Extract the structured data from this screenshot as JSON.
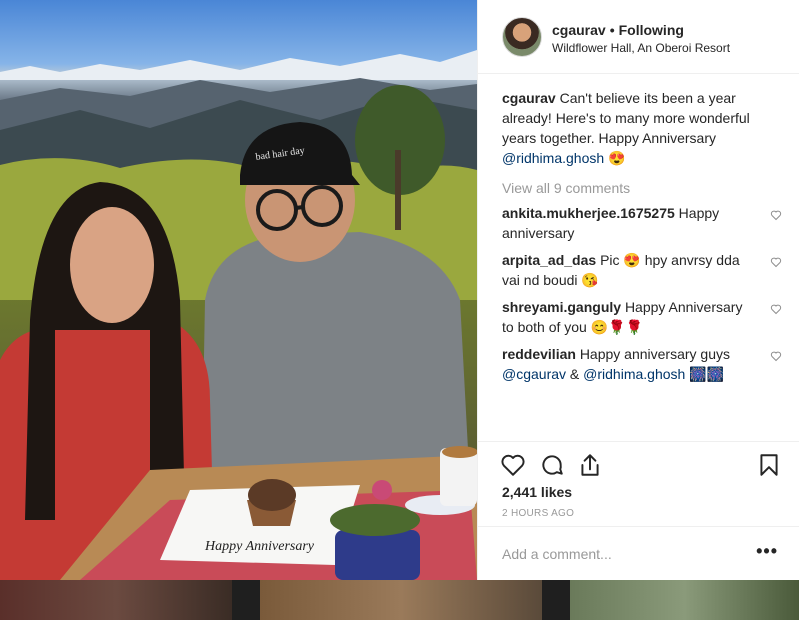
{
  "post": {
    "username": "cgaurav",
    "separator": "•",
    "follow_status": "Following",
    "location": "Wildflower Hall, An Oberoi Resort",
    "caption": {
      "username": "cgaurav",
      "text": "Can't believe its been a year already! Here's to many more wonderful years together. Happy Anniversary",
      "mention": "@ridhima.ghosh",
      "emoji": "😍"
    },
    "view_all_comments": "View all 9 comments",
    "comments": [
      {
        "username": "ankita.mukherjee.1675275",
        "text": "Happy anniversary"
      },
      {
        "username": "arpita_ad_das",
        "text": "Pic 😍 hpy anvrsy dda vai nd boudi 😘"
      },
      {
        "username": "shreyami.ganguly",
        "text": "Happy Anniversary to both of you 😊🌹🌹"
      },
      {
        "username": "reddevilian",
        "text": "Happy anniversary guys",
        "mention1": "@cgaurav",
        "amp": "&",
        "mention2": "@ridhima.ghosh",
        "emoji": "🎆🎆"
      }
    ],
    "likes": "2,441 likes",
    "time_ago": "2 HOURS AGO",
    "add_comment_placeholder": "Add a comment...",
    "more_label": "•••"
  },
  "photo": {
    "cake_plate_text": "Happy Anniversary",
    "cap_text": "bad hair day"
  },
  "icons": [
    "heart-icon",
    "comment-icon",
    "share-icon",
    "bookmark-icon",
    "small-heart-icon"
  ]
}
